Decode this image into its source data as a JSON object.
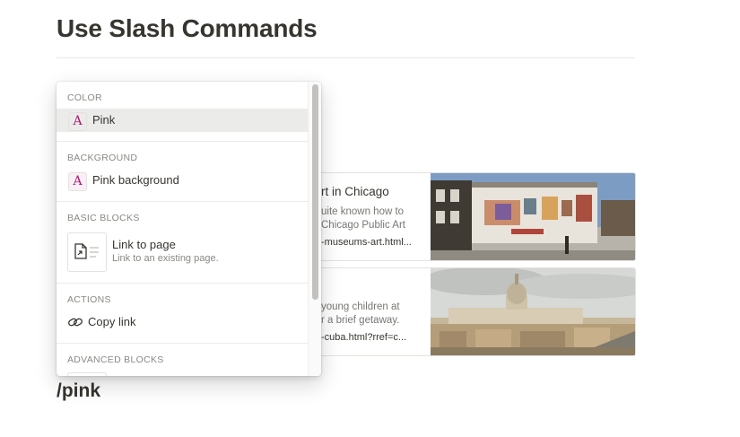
{
  "page": {
    "title": "Use Slash Commands",
    "command_text": "/pink"
  },
  "bookmarks": [
    {
      "title": "rt in Chicago",
      "description_lines": [
        "uite known how to",
        "Chicago Public Art"
      ],
      "url": "-museums-art.html..."
    },
    {
      "title": "",
      "description_lines": [
        "young children at",
        "r a brief getaway."
      ],
      "url": "-cuba.html?rref=c..."
    }
  ],
  "slash_menu": {
    "sections": {
      "color": "COLOR",
      "background": "BACKGROUND",
      "basic_blocks": "BASIC BLOCKS",
      "actions": "ACTIONS",
      "advanced_blocks": "ADVANCED BLOCKS"
    },
    "items": {
      "pink": {
        "glyph": "A",
        "label": "Pink"
      },
      "pink_background": {
        "glyph": "A",
        "label": "Pink background"
      },
      "link_to_page": {
        "label": "Link to page",
        "sublabel": "Link to an existing page."
      },
      "copy_link": {
        "label": "Copy link"
      }
    }
  },
  "colors": {
    "pink_text": "#ad1a72",
    "pink_bg": "#f9f0f5",
    "selected_row": "#ebebea"
  }
}
